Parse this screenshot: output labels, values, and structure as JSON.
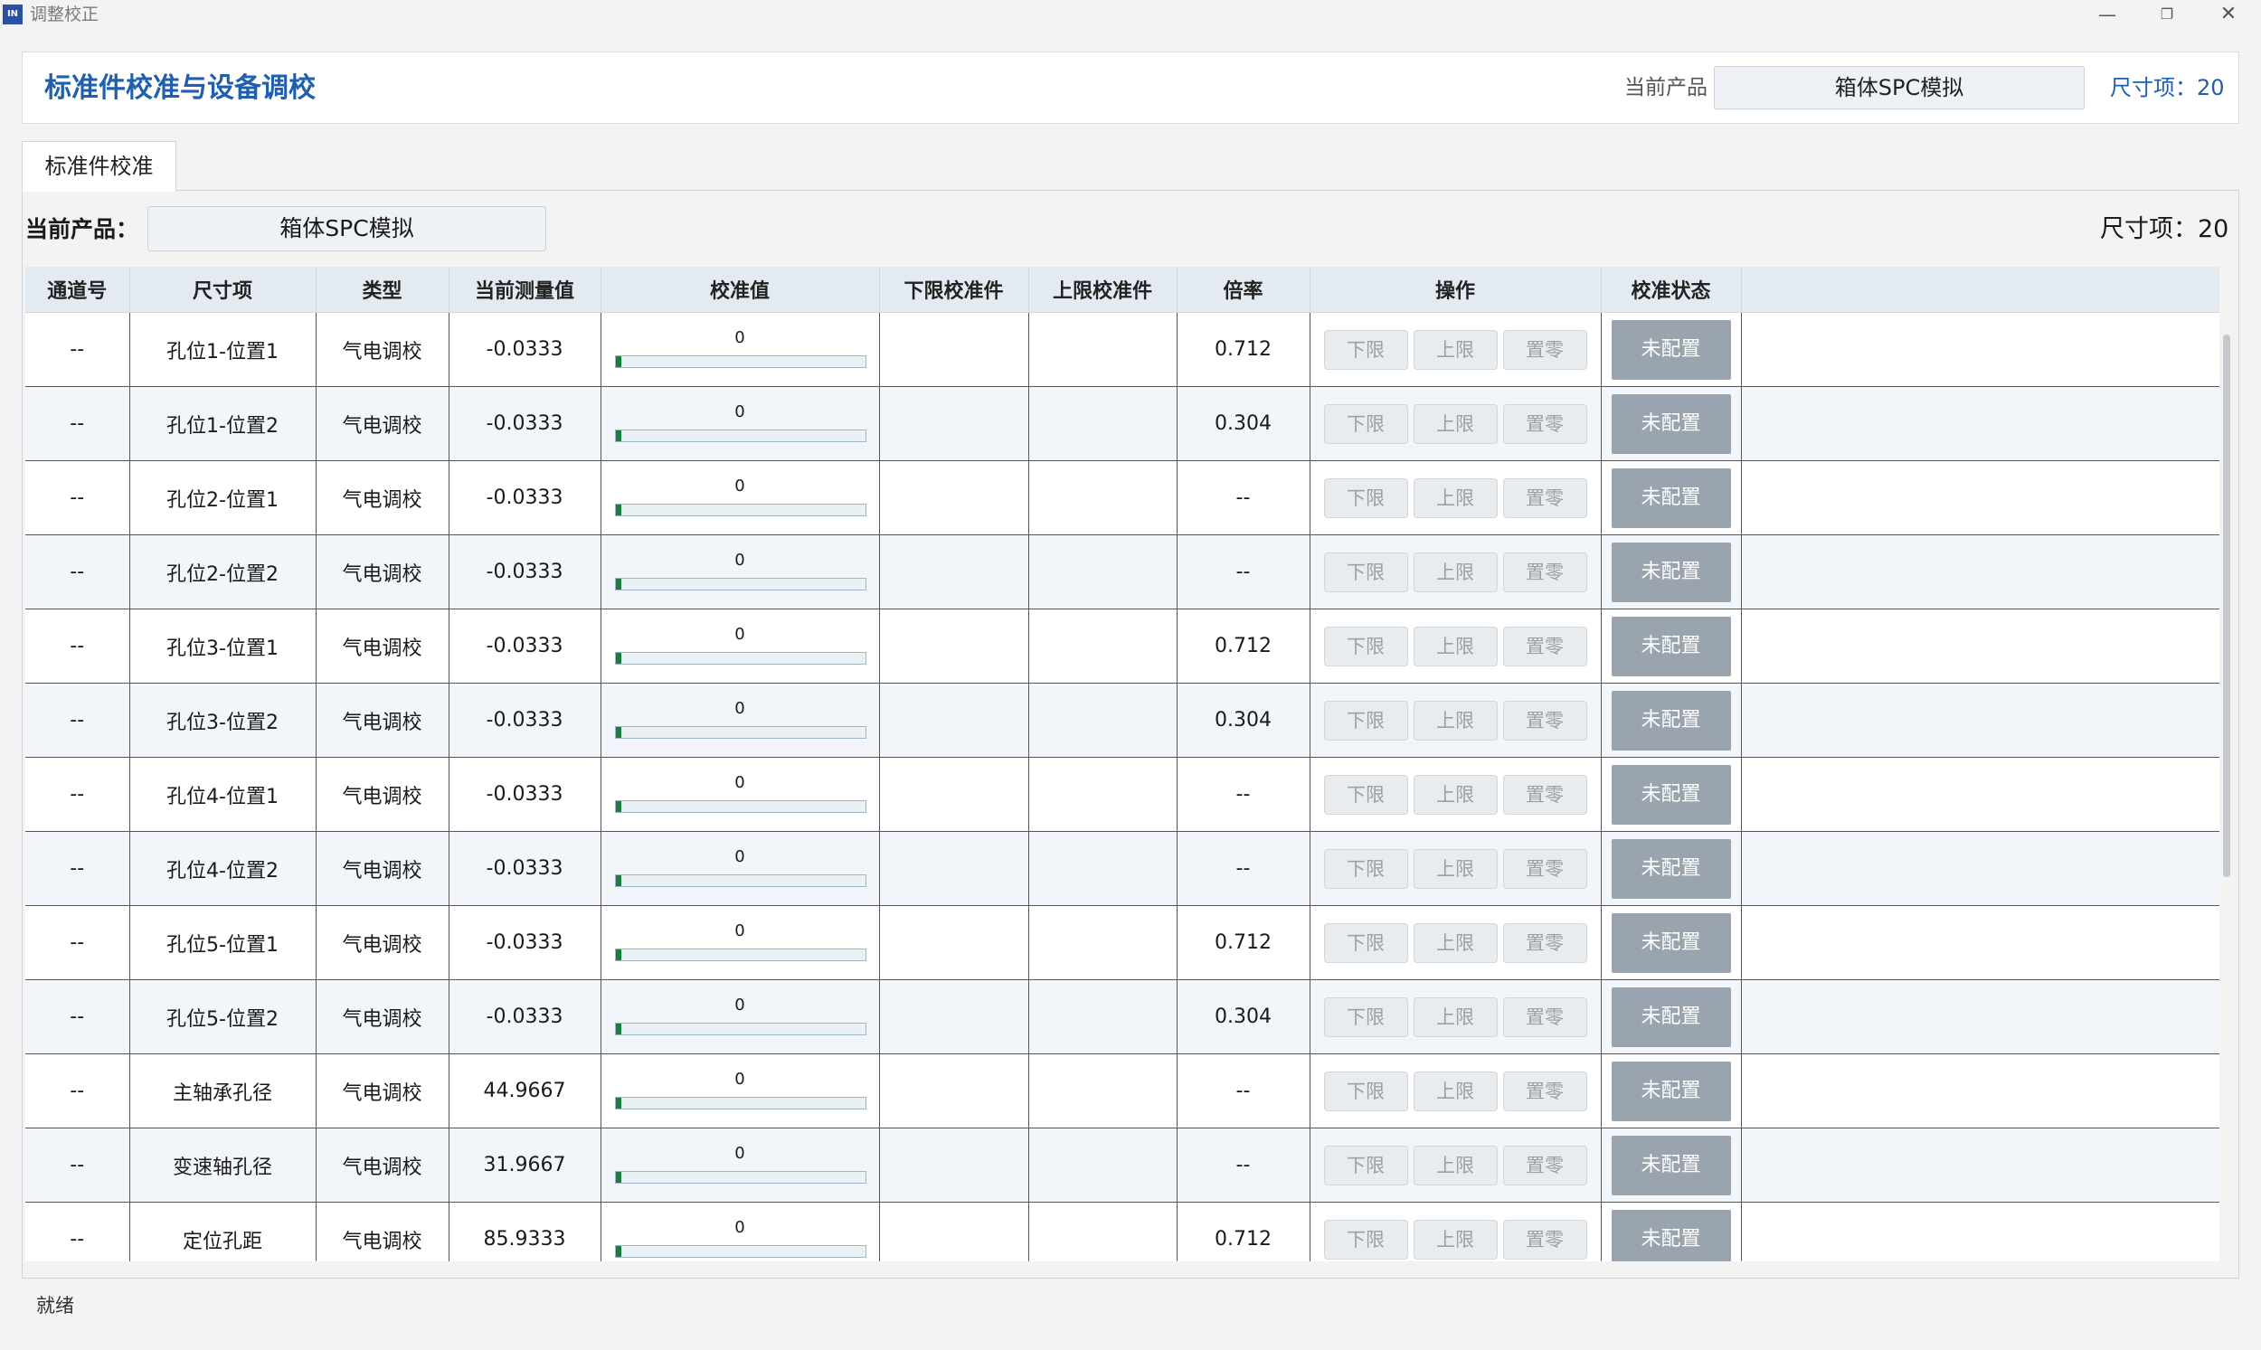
{
  "window": {
    "icon_text": "IN",
    "title": "调整校正",
    "min": "—",
    "max": "❐",
    "close": "✕"
  },
  "header": {
    "title": "标准件校准与设备调校",
    "product_label": "当前产品",
    "product": "箱体SPC模拟",
    "count": "尺寸项：20"
  },
  "tab": {
    "label": "标准件校准"
  },
  "panel": {
    "product_label": "当前产品：",
    "product": "箱体SPC模拟",
    "count": "尺寸项：20"
  },
  "table": {
    "headers": [
      "通道号",
      "尺寸项",
      "类型",
      "当前测量值",
      "校准值",
      "下限校准件",
      "上限校准件",
      "倍率",
      "操作",
      "校准状态"
    ],
    "buttons": {
      "lower": "下限",
      "upper": "上限",
      "zero": "置零",
      "status": "未配置"
    },
    "rows": [
      {
        "channel": "--",
        "item": "孔位1-位置1",
        "type": "气电调校",
        "measured": "-0.0333",
        "calib": "0",
        "lower": "",
        "upper": "",
        "ratio": "0.712"
      },
      {
        "channel": "--",
        "item": "孔位1-位置2",
        "type": "气电调校",
        "measured": "-0.0333",
        "calib": "0",
        "lower": "",
        "upper": "",
        "ratio": "0.304"
      },
      {
        "channel": "--",
        "item": "孔位2-位置1",
        "type": "气电调校",
        "measured": "-0.0333",
        "calib": "0",
        "lower": "",
        "upper": "",
        "ratio": "--"
      },
      {
        "channel": "--",
        "item": "孔位2-位置2",
        "type": "气电调校",
        "measured": "-0.0333",
        "calib": "0",
        "lower": "",
        "upper": "",
        "ratio": "--"
      },
      {
        "channel": "--",
        "item": "孔位3-位置1",
        "type": "气电调校",
        "measured": "-0.0333",
        "calib": "0",
        "lower": "",
        "upper": "",
        "ratio": "0.712"
      },
      {
        "channel": "--",
        "item": "孔位3-位置2",
        "type": "气电调校",
        "measured": "-0.0333",
        "calib": "0",
        "lower": "",
        "upper": "",
        "ratio": "0.304"
      },
      {
        "channel": "--",
        "item": "孔位4-位置1",
        "type": "气电调校",
        "measured": "-0.0333",
        "calib": "0",
        "lower": "",
        "upper": "",
        "ratio": "--"
      },
      {
        "channel": "--",
        "item": "孔位4-位置2",
        "type": "气电调校",
        "measured": "-0.0333",
        "calib": "0",
        "lower": "",
        "upper": "",
        "ratio": "--"
      },
      {
        "channel": "--",
        "item": "孔位5-位置1",
        "type": "气电调校",
        "measured": "-0.0333",
        "calib": "0",
        "lower": "",
        "upper": "",
        "ratio": "0.712"
      },
      {
        "channel": "--",
        "item": "孔位5-位置2",
        "type": "气电调校",
        "measured": "-0.0333",
        "calib": "0",
        "lower": "",
        "upper": "",
        "ratio": "0.304"
      },
      {
        "channel": "--",
        "item": "主轴承孔径",
        "type": "气电调校",
        "measured": "44.9667",
        "calib": "0",
        "lower": "",
        "upper": "",
        "ratio": "--"
      },
      {
        "channel": "--",
        "item": "变速轴孔径",
        "type": "气电调校",
        "measured": "31.9667",
        "calib": "0",
        "lower": "",
        "upper": "",
        "ratio": "--"
      },
      {
        "channel": "--",
        "item": "定位孔距",
        "type": "气电调校",
        "measured": "85.9333",
        "calib": "0",
        "lower": "",
        "upper": "",
        "ratio": "0.712"
      }
    ]
  },
  "status": {
    "text": "就绪"
  }
}
